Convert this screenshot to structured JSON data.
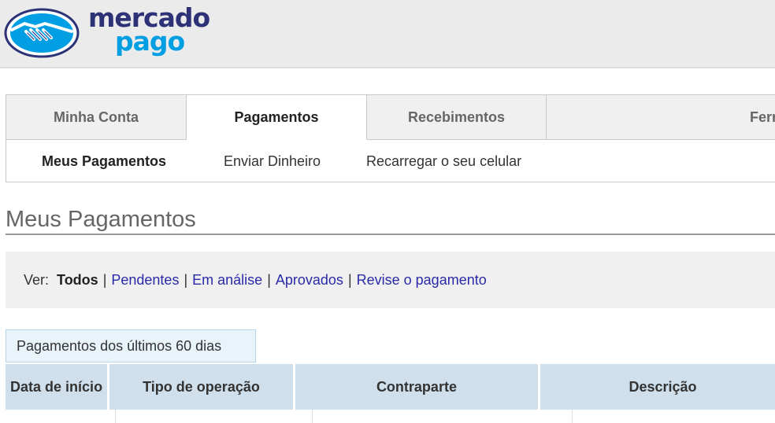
{
  "brand": {
    "line1": "mercado",
    "line2": "pago",
    "colors": {
      "navy": "#2d3277",
      "blue": "#009ee3"
    },
    "icon": "handshake-icon"
  },
  "tabs": [
    {
      "label": "Minha Conta",
      "active": false
    },
    {
      "label": "Pagamentos",
      "active": true
    },
    {
      "label": "Recebimentos",
      "active": false
    },
    {
      "label": "Ferrame",
      "active": false
    }
  ],
  "subnav": [
    {
      "label": "Meus Pagamentos",
      "active": true
    },
    {
      "label": "Enviar Dinheiro",
      "active": false
    },
    {
      "label": "Recarregar o seu celular",
      "active": false
    }
  ],
  "page_title": "Meus Pagamentos",
  "filter": {
    "label": "Ver:",
    "current": "Todos",
    "options": [
      "Pendentes",
      "Em análise",
      "Aprovados",
      "Revise o pagamento"
    ],
    "separator": "|",
    "link_color": "#2a2aa8"
  },
  "period_tab": "Pagamentos dos últimos 60 dias",
  "table": {
    "headers": [
      "Data de início",
      "Tipo de operação",
      "Contraparte",
      "Descrição"
    ]
  }
}
